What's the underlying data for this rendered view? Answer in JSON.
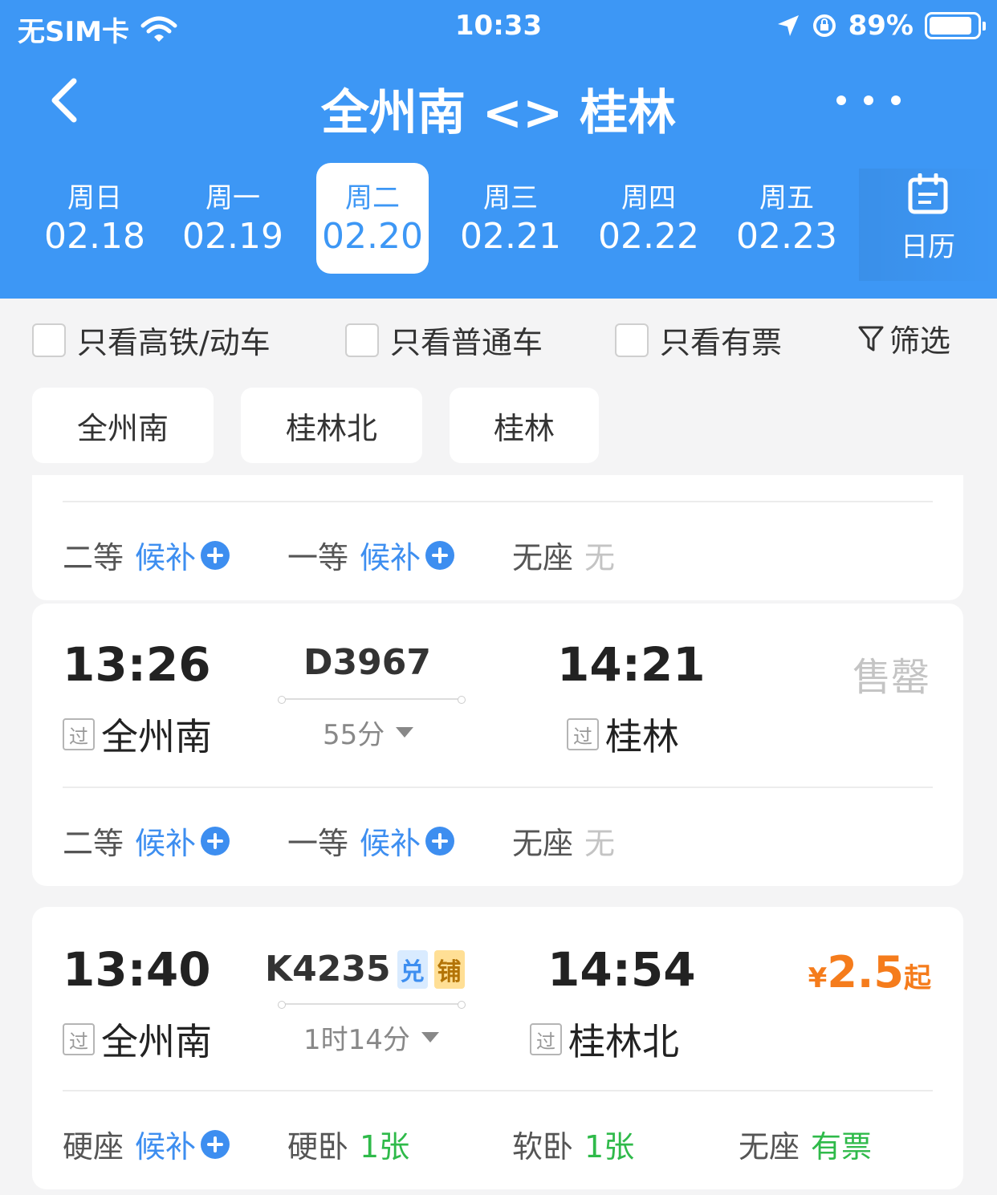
{
  "status_bar": {
    "carrier": "无SIM卡",
    "time": "10:33",
    "battery": "89%",
    "battery_level": 0.89
  },
  "nav": {
    "title": "全州南 <> 桂林"
  },
  "dates": [
    {
      "dow": "周日",
      "md": "02.18"
    },
    {
      "dow": "周一",
      "md": "02.19"
    },
    {
      "dow": "周二",
      "md": "02.20"
    },
    {
      "dow": "周三",
      "md": "02.21"
    },
    {
      "dow": "周四",
      "md": "02.22"
    },
    {
      "dow": "周五",
      "md": "02.23"
    }
  ],
  "selected_date_index": 2,
  "calendar_label": "日历",
  "filters": {
    "high_speed": "只看高铁/动车",
    "normal": "只看普通车",
    "available": "只看有票",
    "filter_btn": "筛选"
  },
  "stations": [
    "全州南",
    "桂林北",
    "桂林"
  ],
  "partial_card": {
    "seats": [
      {
        "type": "二等",
        "status": "候补"
      },
      {
        "type": "一等",
        "status": "候补"
      },
      {
        "type": "无座",
        "status": "无"
      }
    ]
  },
  "trains": [
    {
      "dep_time": "13:26",
      "dep_station": "全州南",
      "dep_badge": "过",
      "train_no": "D3967",
      "duration": "55分",
      "arr_time": "14:21",
      "arr_station": "桂林",
      "arr_badge": "过",
      "status": "售罄",
      "seats": [
        {
          "type": "二等",
          "status": "候补"
        },
        {
          "type": "一等",
          "status": "候补"
        },
        {
          "type": "无座",
          "status": "无"
        }
      ]
    },
    {
      "dep_time": "13:40",
      "dep_station": "全州南",
      "dep_badge": "过",
      "train_no": "K4235",
      "tags": [
        "兑",
        "铺"
      ],
      "duration": "1时14分",
      "arr_time": "14:54",
      "arr_station": "桂林北",
      "arr_badge": "过",
      "price": {
        "currency": "¥",
        "amount": "2.5",
        "suffix": "起"
      },
      "seats": [
        {
          "type": "硬座",
          "status": "候补"
        },
        {
          "type": "硬卧",
          "status": "1张"
        },
        {
          "type": "软卧",
          "status": "1张"
        },
        {
          "type": "无座",
          "status": "有票"
        }
      ]
    }
  ],
  "colors": {
    "header": "#3d97f5",
    "accent_blue": "#3d8ef0",
    "price_orange": "#f57c1c",
    "available_green": "#2fba4a",
    "sold_gray": "#c4c4c4"
  }
}
